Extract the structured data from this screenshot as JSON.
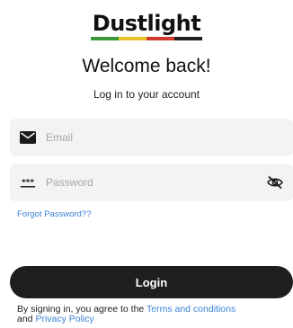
{
  "brand": {
    "name": "Dustlight",
    "bar_colors": [
      "#3a9a3a",
      "#e6c12a",
      "#d23a2a",
      "#1e1e1e"
    ]
  },
  "header": {
    "title": "Welcome back!",
    "subtitle": "Log in to your account"
  },
  "form": {
    "email_placeholder": "Email",
    "email_icon": "mail-icon",
    "password_placeholder": "Password",
    "password_icon": "password-dots-icon",
    "password_toggle_icon": "eye-off-icon",
    "forgot_label": "Forgot Password??",
    "login_label": "Login"
  },
  "terms": {
    "prefix": "By signing in, you agree to the ",
    "terms_link": "Terms and conditions",
    "connector": "and ",
    "privacy_link": "Privacy Policy"
  },
  "colors": {
    "link": "#3b82d6",
    "button": "#1e1e1e",
    "field_bg": "#f3f3f3"
  }
}
